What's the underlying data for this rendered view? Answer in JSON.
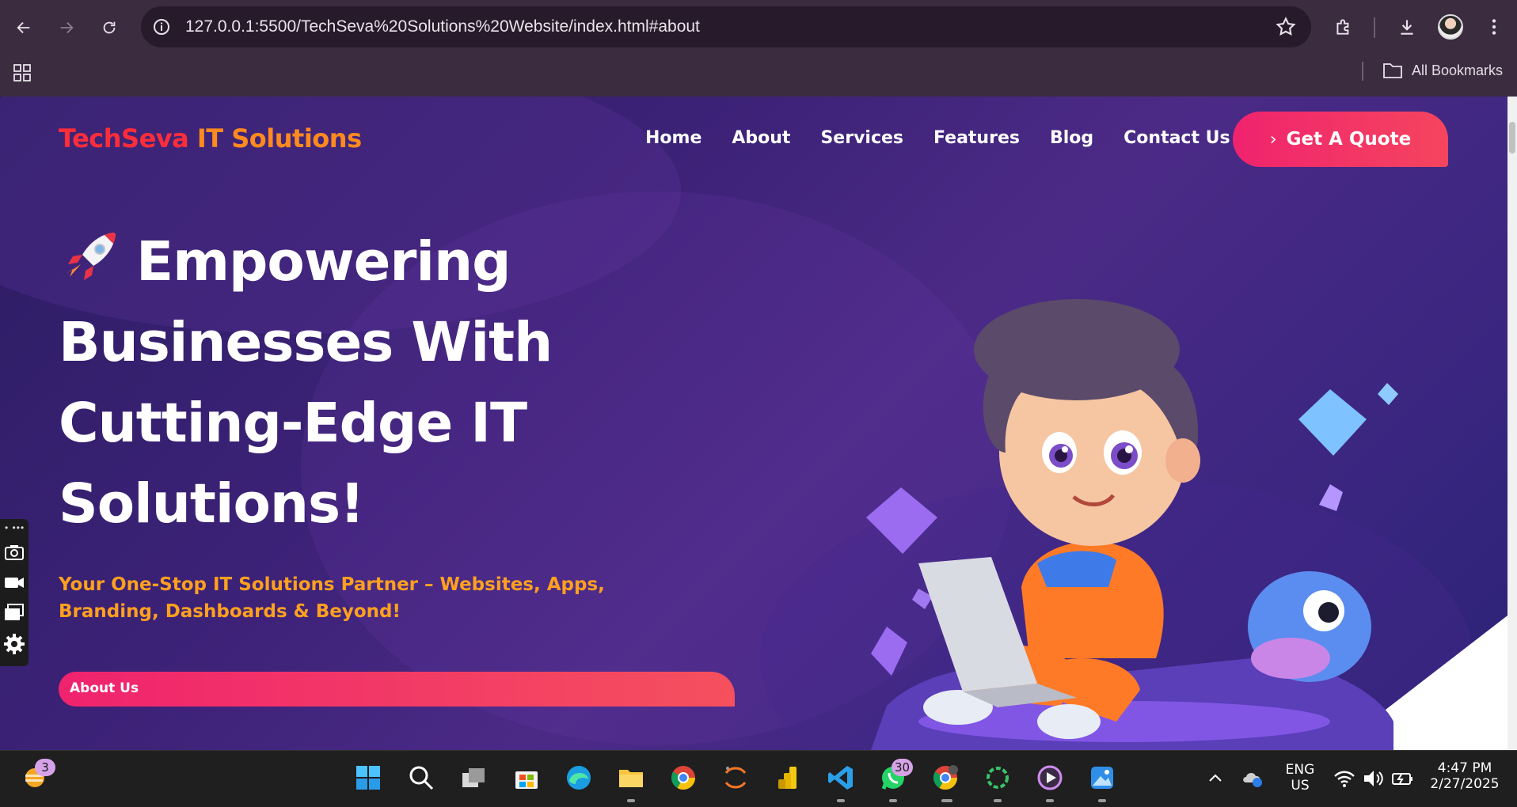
{
  "browser": {
    "url": "127.0.0.1:5500/TechSeva%20Solutions%20Website/index.html#about",
    "bookmarks_label": "All Bookmarks"
  },
  "site": {
    "logo_part1": "TechSeva",
    "logo_part2": "IT Solutions",
    "nav": [
      "Home",
      "About",
      "Services",
      "Features",
      "Blog",
      "Contact Us"
    ],
    "cta_label": "Get A Quote",
    "headline": [
      "Empowering",
      "Businesses With",
      "Cutting-Edge IT",
      "Solutions!"
    ],
    "subline": "Your One-Stop IT Solutions Partner – Websites, Apps, Branding, Dashboards & Beyond!",
    "about_bar_label": "About Us",
    "colors": {
      "logo_red": "#ff2d3a",
      "logo_orange": "#ff8a1e",
      "cta_pink": "#f0236e",
      "subline_orange": "#ffa01f",
      "hero_bg": "#3d2278"
    }
  },
  "taskbar": {
    "weather_badge": "3",
    "whatsapp_badge": "30",
    "lang_line1": "ENG",
    "lang_line2": "US",
    "time": "4:47 PM",
    "date": "2/27/2025",
    "icons": [
      "weather-icon",
      "start-icon",
      "search-icon",
      "task-view-icon",
      "store-icon",
      "edge-icon",
      "file-explorer-icon",
      "chrome-icon",
      "jupyter-icon",
      "power-bi-icon",
      "vscode-icon",
      "whatsapp-icon",
      "chrome-profile-icon",
      "loading-app-icon",
      "media-player-icon",
      "photos-icon"
    ]
  }
}
